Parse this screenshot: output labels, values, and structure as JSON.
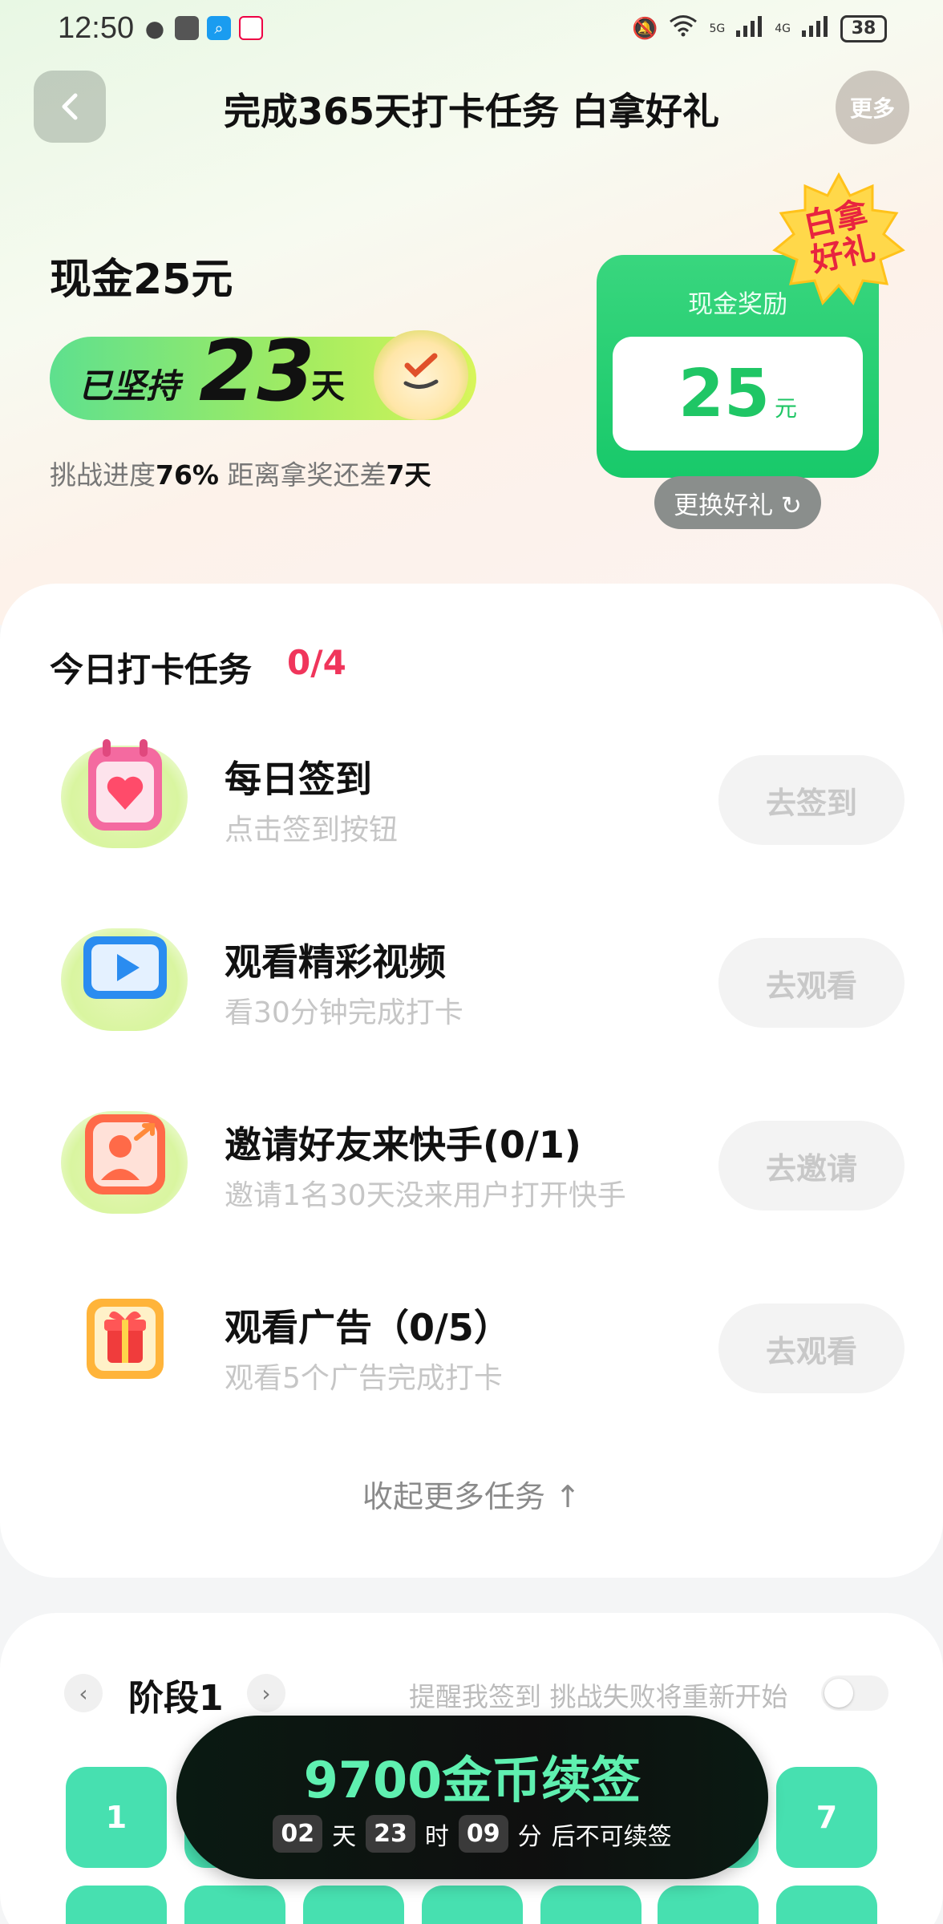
{
  "status_bar": {
    "time": "12:50",
    "network_labels": [
      "5G",
      "4G"
    ],
    "battery": "38"
  },
  "header": {
    "title": "完成365天打卡任务 白拿好礼",
    "more_label": "更多"
  },
  "hero": {
    "cash_title": "现金25元",
    "persist_prefix": "已坚持",
    "persist_days": "23",
    "persist_suffix": "天",
    "progress_label": "挑战进度",
    "progress_value": "76%",
    "remaining_label": "距离拿奖还差",
    "remaining_value": "7天",
    "reward_label": "现金奖励",
    "reward_amount": "25",
    "reward_unit": "元",
    "badge_line1": "白拿",
    "badge_line2": "好礼",
    "change_gift_label": "更换好礼 ↻"
  },
  "tasks": {
    "header": "今日打卡任务",
    "count": "0/4",
    "items": [
      {
        "title": "每日签到",
        "subtitle": "点击签到按钮",
        "button": "去签到",
        "icon": "calendar-heart-icon"
      },
      {
        "title": "观看精彩视频",
        "subtitle": "看30分钟完成打卡",
        "button": "去观看",
        "icon": "video-play-icon"
      },
      {
        "title": "邀请好友来快手(0/1)",
        "subtitle": "邀请1名30天没来用户打开快手",
        "button": "去邀请",
        "icon": "invite-friend-icon"
      },
      {
        "title": "观看广告（0/5）",
        "subtitle": "观看5个广告完成打卡",
        "button": "去观看",
        "icon": "gift-box-icon"
      }
    ],
    "collapse_label": "收起更多任务 ↑"
  },
  "stage": {
    "title": "阶段1",
    "prev_icon": "‹",
    "next_icon": "›",
    "remind_text": "提醒我签到 挑战失败将重新开始",
    "days": [
      "1",
      "7"
    ]
  },
  "renew": {
    "title": "9700金币续签",
    "days": "02",
    "days_unit": "天",
    "hours": "23",
    "hours_unit": "时",
    "minutes": "09",
    "minutes_unit": "分",
    "suffix": "后不可续签"
  },
  "colors": {
    "accent_green": "#1fc665",
    "count_red": "#f0355b",
    "day_tile": "#47e0b0",
    "renew_text": "#5ff0b0"
  }
}
